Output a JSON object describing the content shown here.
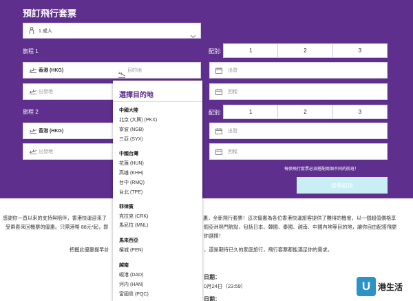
{
  "booking": {
    "title": "預訂飛行套票",
    "passengers": "1 成人",
    "trip1_label": "旅程 1",
    "trip2_label": "旅程 2",
    "stays_label": "配別:",
    "stay_options": [
      "1",
      "2",
      "3"
    ],
    "origin_value": "香港 (HKG)",
    "dest_placeholder": "目的地",
    "depart_placeholder": "出發地",
    "date_depart": "出發",
    "date_return": "回程",
    "note": "每張飛行套票必須搭配兩個不同的航班！",
    "submit_label": "搜尋航班"
  },
  "dropdown": {
    "heading": "選擇目的地",
    "groups": [
      {
        "name": "中國大陸",
        "items": [
          "北京 (大興) (PKX)",
          "寧波 (NGB)",
          "三亞 (SYX)"
        ]
      },
      {
        "name": "中國台灣",
        "items": [
          "花蓮 (HUN)",
          "高雄 (KHH)",
          "台中 (RMQ)",
          "台北 (TPE)"
        ]
      },
      {
        "name": "菲律賓",
        "items": [
          "克拉克 (CRK)",
          "馬尼拉 (MNL)"
        ]
      },
      {
        "name": "馬來西亞",
        "items": [
          "檳城 (PEN)"
        ]
      },
      {
        "name": "越南",
        "items": [
          "峴港 (DAD)",
          "河内 (HAN)",
          "富國島 (PQC)"
        ]
      }
    ]
  },
  "article": {
    "p1_left": "感謝你一直以來的支持與陪伴，香港快運迎來了",
    "p1_right": "惠，全新飛行套票！這次優惠為各位香港快運旅客提供了難得的機會，以一個超值價格享",
    "p2_left": "受兩套來回機票的優惠。只需港幣 88元*起，即",
    "p2_right": "個亞洲熱門航點，包括日本、韓國、泰國、越南、中國內地等目的地，讓你自由配搭飛更",
    "p3_right": "你選擇！",
    "p4_left": "把握此優惠提早計",
    "p4_right": "，還是期待已久的家庭旅行，飛行套票都能滿足你的需求。",
    "date1_label": "日期：",
    "date1_value": "0月24日（23:59）",
    "date2_label": "日期："
  },
  "logo": {
    "mark": "U",
    "text": "港生活"
  }
}
